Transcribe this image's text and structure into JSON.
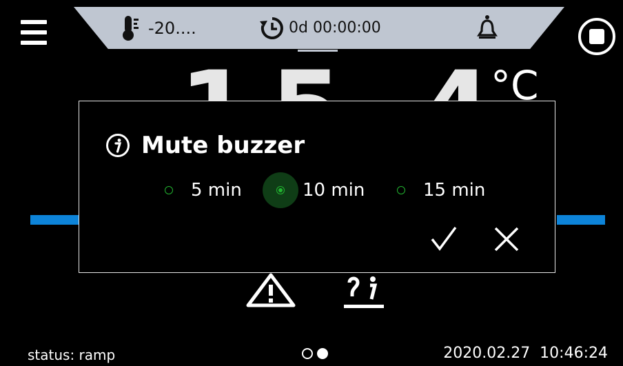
{
  "top_bar": {
    "temperature_value": "-20....",
    "timer_value": "0d 00:00:00",
    "icons": [
      "menu-icon",
      "thermometer-icon",
      "timer-icon",
      "bell-icon",
      "stop-icon"
    ]
  },
  "readout": {
    "temperature": "15.4",
    "unit": "°C"
  },
  "dialog": {
    "title": "Mute buzzer",
    "options": [
      "5 min",
      "10 min",
      "15 min"
    ],
    "selected": "10 min",
    "confirm_icon": "check-icon",
    "cancel_icon": "close-icon"
  },
  "footer": {
    "status": "status: ramp",
    "datetime": "2020.02.27  10:46:24",
    "page_current": 2,
    "page_total": 2
  },
  "colors": {
    "background": "#000000",
    "top_bar": "#bfc6d1",
    "accent_blue": "#0d84d9",
    "radio_green": "#22b430"
  }
}
